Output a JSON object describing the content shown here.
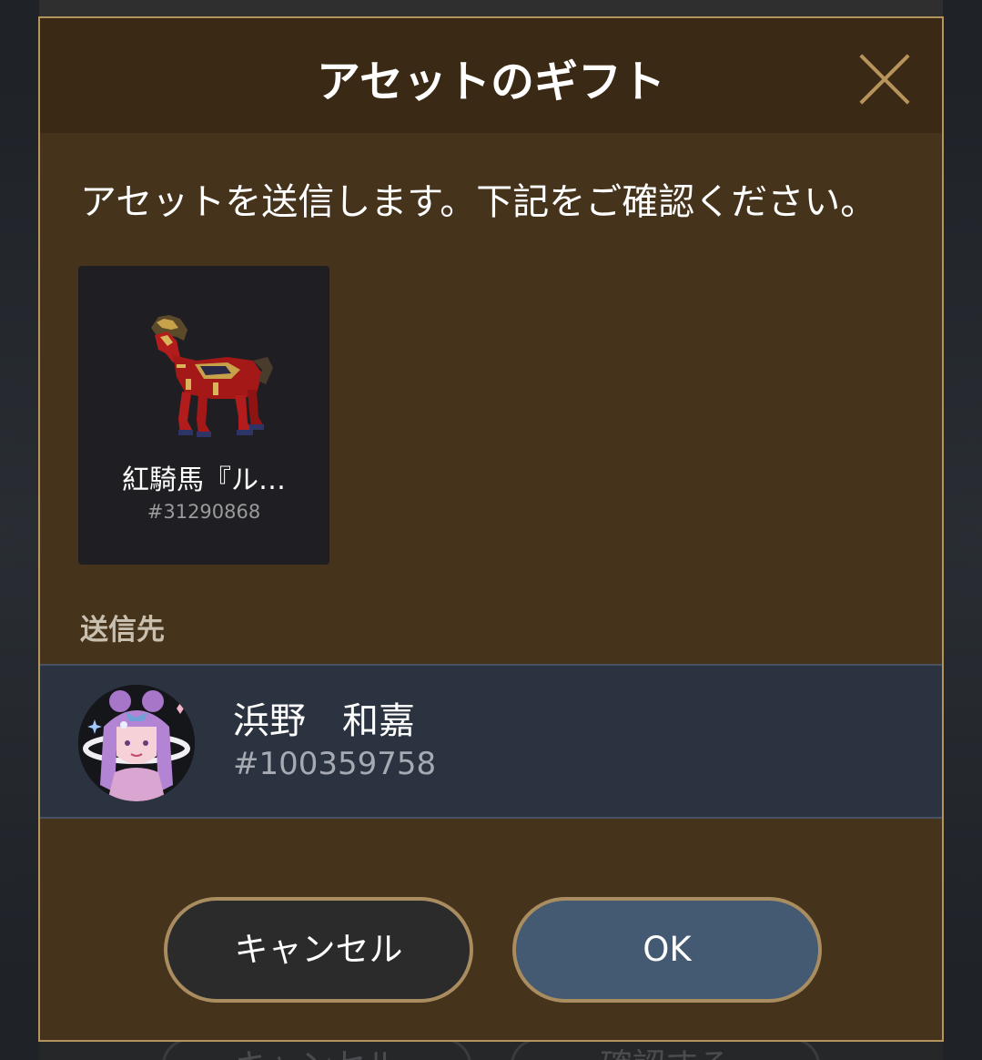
{
  "background": {
    "ghost_cancel": "キャンセル",
    "ghost_confirm": "確認する"
  },
  "dialog": {
    "title": "アセットのギフト",
    "close_icon": "close-icon",
    "message": "アセットを送信します。下記をご確認ください。"
  },
  "asset": {
    "name": "紅騎馬『ル…",
    "id": "#31290868",
    "image": "red-horse-sprite"
  },
  "recipient": {
    "section_label": "送信先",
    "name": "浜野　和嘉",
    "id": "#100359758",
    "avatar": "avatar-icon"
  },
  "buttons": {
    "cancel": "キャンセル",
    "ok": "OK"
  },
  "colors": {
    "dialog_bg": "#46331b",
    "header_bg": "#3a2914",
    "border_gold": "#b4945e",
    "recipient_bg": "#2c3340",
    "ok_bg": "#435a72",
    "cancel_bg": "#2b2b2c"
  }
}
